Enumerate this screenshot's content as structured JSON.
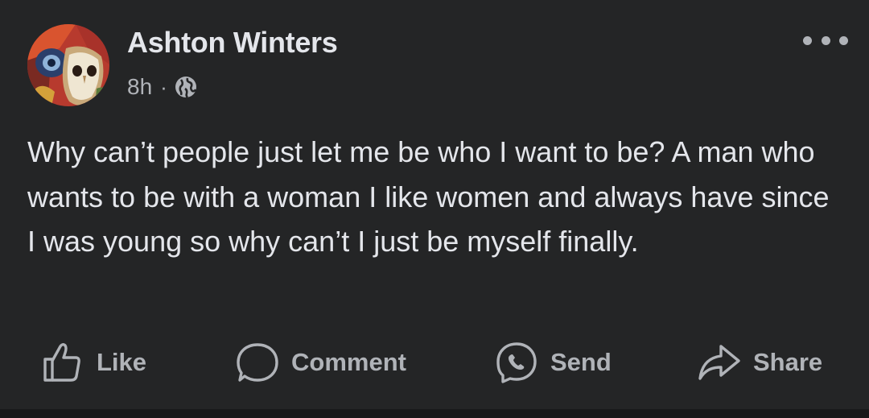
{
  "post": {
    "author": "Ashton Winters",
    "time": "8h",
    "separator": "·",
    "privacy_icon": "globe-icon",
    "more_icon": "more-options-icon",
    "text": "Why can’t people just let me be who I want to be? A man who wants to be with a woman I like women and always have since I was young so why can’t I just be myself finally."
  },
  "actions": [
    {
      "label": "Like",
      "icon": "thumbs-up-icon"
    },
    {
      "label": "Comment",
      "icon": "comment-bubble-icon"
    },
    {
      "label": "Send",
      "icon": "messenger-icon"
    },
    {
      "label": "Share",
      "icon": "share-arrow-icon"
    }
  ],
  "colors": {
    "background": "#242526",
    "primary_text": "#e4e6eb",
    "secondary_text": "#b0b3b8",
    "bottom_bar": "#18191a"
  }
}
